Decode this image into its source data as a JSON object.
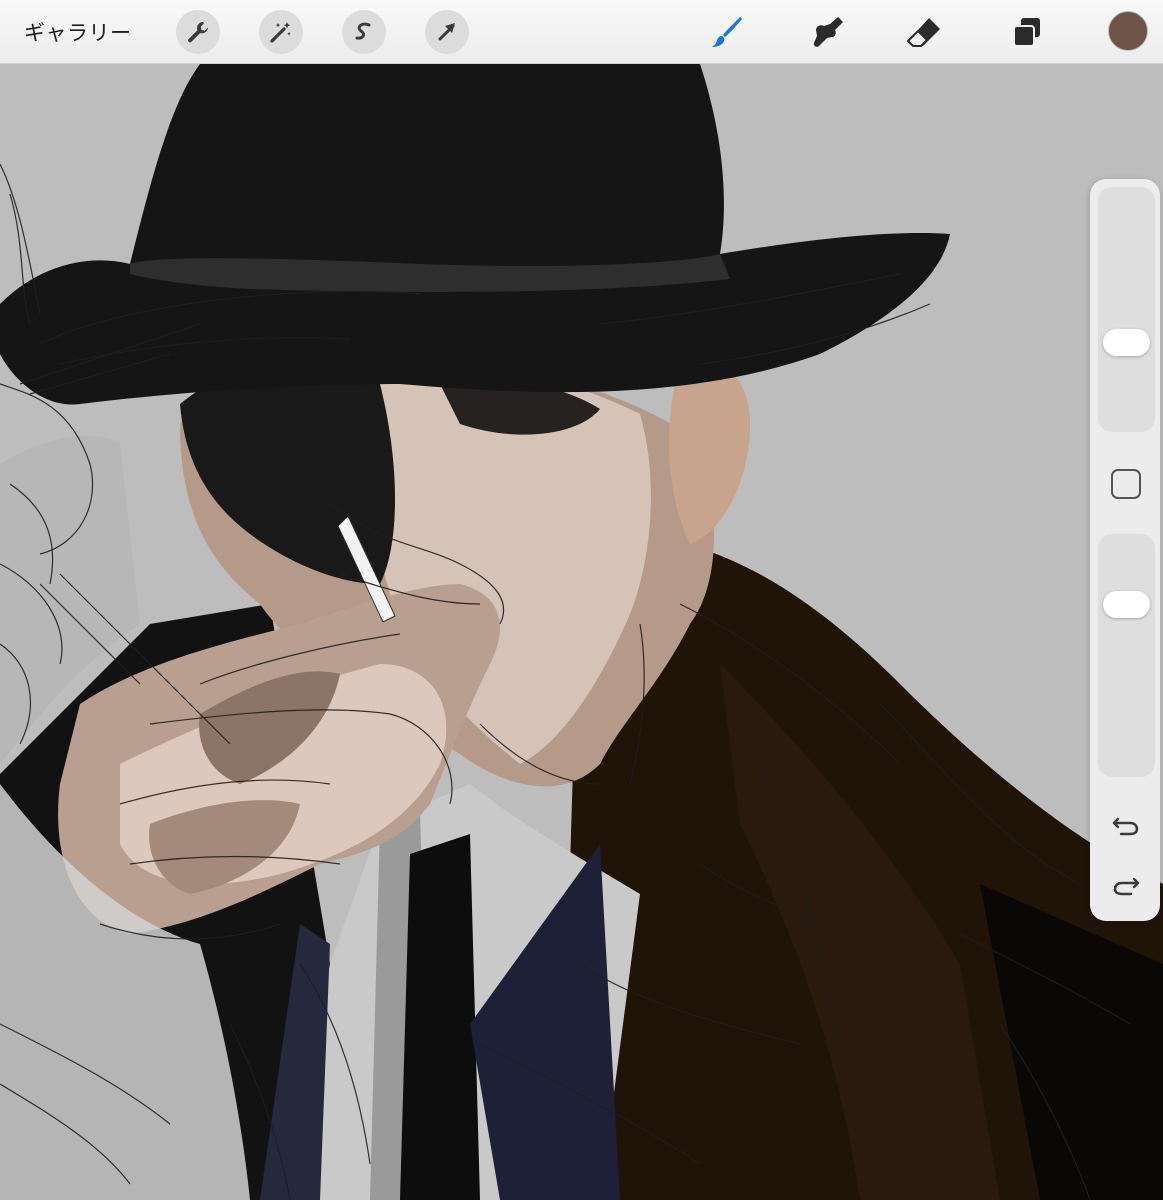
{
  "toolbar": {
    "gallery_label": "ギャラリー",
    "left_tools": [
      {
        "name": "actions-wrench-icon"
      },
      {
        "name": "adjustments-wand-icon"
      },
      {
        "name": "selection-s-icon"
      },
      {
        "name": "transform-arrow-icon"
      }
    ],
    "right_tools": [
      {
        "name": "brush-icon",
        "active": true
      },
      {
        "name": "smudge-icon"
      },
      {
        "name": "eraser-icon"
      },
      {
        "name": "layers-icon"
      }
    ],
    "current_color": "#6e5447",
    "active_color": "#1a73e8"
  },
  "sidebar": {
    "brush_size_level": 0.62,
    "opacity_level": 0.3,
    "modify_button": "square-icon",
    "undo_icon": "undo-icon",
    "redo_icon": "redo-icon"
  }
}
